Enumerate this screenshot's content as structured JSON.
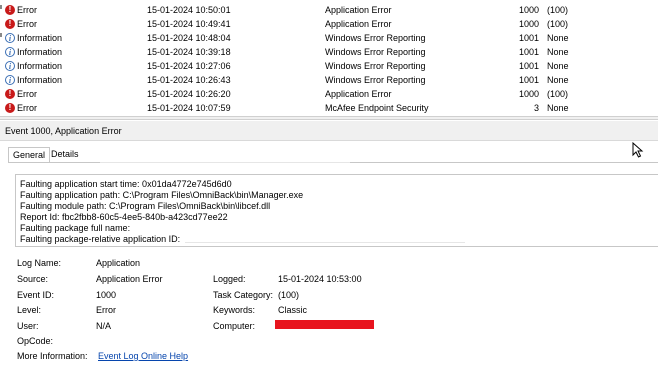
{
  "events": [
    {
      "level": "Error",
      "icon": "error-icon",
      "datetime": "15-01-2024 10:50:01",
      "source": "Application Error",
      "event_id": "1000",
      "category": "(100)"
    },
    {
      "level": "Error",
      "icon": "error-icon",
      "datetime": "15-01-2024 10:49:41",
      "source": "Application Error",
      "event_id": "1000",
      "category": "(100)"
    },
    {
      "level": "Information",
      "icon": "info-icon",
      "datetime": "15-01-2024 10:48:04",
      "source": "Windows Error Reporting",
      "event_id": "1001",
      "category": "None"
    },
    {
      "level": "Information",
      "icon": "info-icon",
      "datetime": "15-01-2024 10:39:18",
      "source": "Windows Error Reporting",
      "event_id": "1001",
      "category": "None"
    },
    {
      "level": "Information",
      "icon": "info-icon",
      "datetime": "15-01-2024 10:27:06",
      "source": "Windows Error Reporting",
      "event_id": "1001",
      "category": "None"
    },
    {
      "level": "Information",
      "icon": "info-icon",
      "datetime": "15-01-2024 10:26:43",
      "source": "Windows Error Reporting",
      "event_id": "1001",
      "category": "None"
    },
    {
      "level": "Error",
      "icon": "error-icon",
      "datetime": "15-01-2024 10:26:20",
      "source": "Application Error",
      "event_id": "1000",
      "category": "(100)"
    },
    {
      "level": "Error",
      "icon": "error-icon",
      "datetime": "15-01-2024 10:07:59",
      "source": "McAfee Endpoint Security",
      "event_id": "3",
      "category": "None"
    }
  ],
  "detail": {
    "title": "Event 1000, Application Error",
    "tabs": {
      "general": "General",
      "details": "Details"
    },
    "description_lines": [
      "Faulting application start time: 0x01da4772e745d6d0",
      "Faulting application path: C:\\Program Files\\OmniBack\\bin\\Manager.exe",
      "Faulting module path: C:\\Program Files\\OmniBack\\bin\\libcef.dll",
      "Report Id: fbc2fbb8-60c5-4ee5-840b-a423cd77ee22",
      "Faulting package full name:",
      "Faulting package-relative application ID:"
    ],
    "properties": {
      "log_name_label": "Log Name:",
      "log_name_value": "Application",
      "source_label": "Source:",
      "source_value": "Application Error",
      "logged_label": "Logged:",
      "logged_value": "15-01-2024 10:53:00",
      "event_id_label": "Event ID:",
      "event_id_value": "1000",
      "task_category_label": "Task Category:",
      "task_category_value": "(100)",
      "level_label": "Level:",
      "level_value": "Error",
      "keywords_label": "Keywords:",
      "keywords_value": "Classic",
      "user_label": "User:",
      "user_value": "N/A",
      "computer_label": "Computer:",
      "opcode_label": "OpCode:",
      "more_info_label": "More Information:",
      "more_info_link": "Event Log Online Help"
    }
  },
  "colors": {
    "error_icon": "#c81a1a",
    "info_icon": "#3b6fb5",
    "redaction": "#e8141e",
    "link": "#0645ad"
  }
}
